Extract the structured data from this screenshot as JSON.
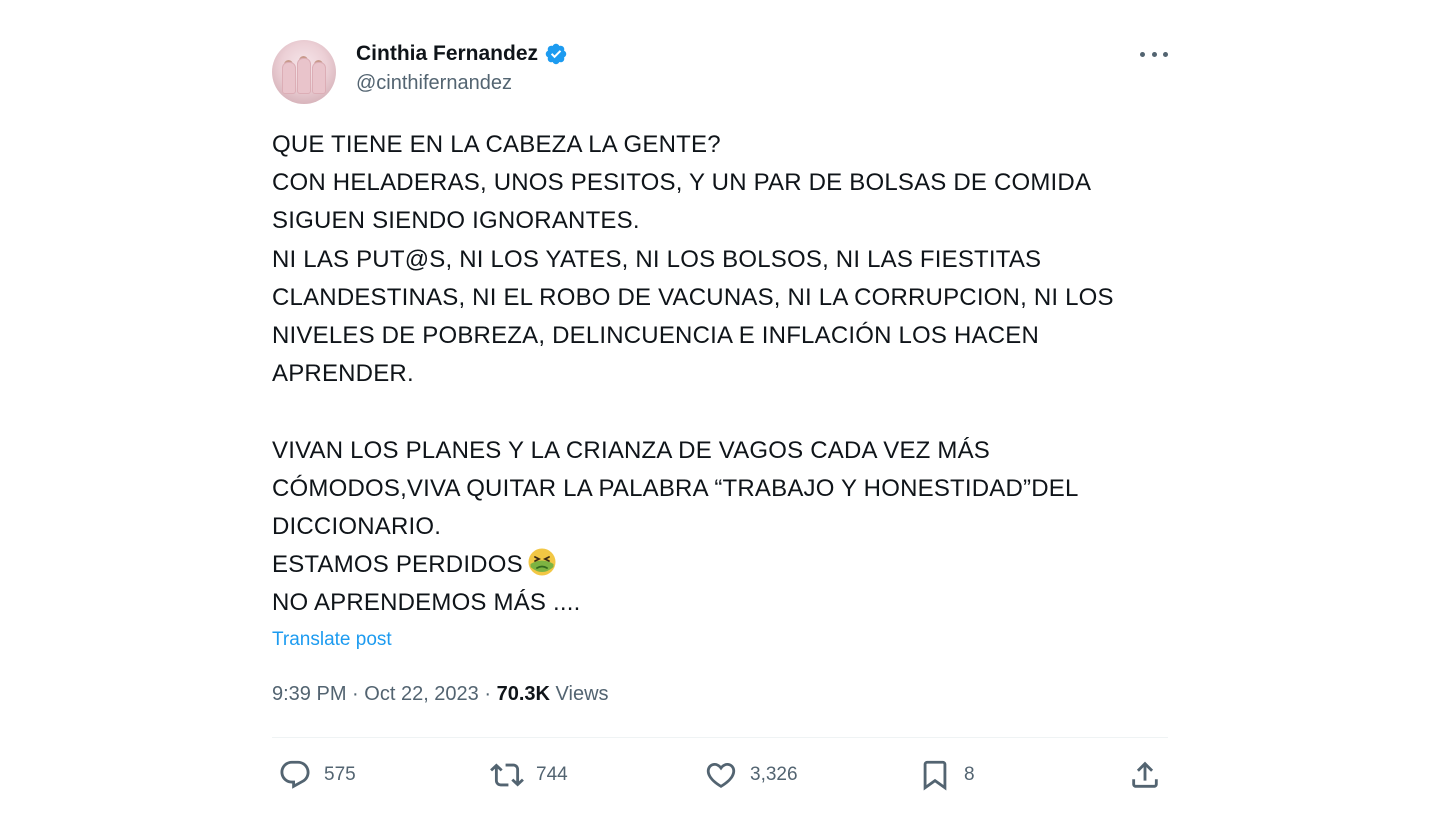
{
  "author": {
    "display_name": "Cinthia Fernandez",
    "handle": "@cinthifernandez",
    "verified_icon": "verified-badge-icon"
  },
  "tweet": {
    "lines": [
      "QUE TIENE EN LA CABEZA LA GENTE?",
      "CON HELADERAS, UNOS PESITOS, Y UN PAR DE BOLSAS DE COMIDA",
      "SIGUEN SIENDO IGNORANTES.",
      "NI LAS PUT@S, NI LOS YATES, NI LOS BOLSOS, NI LAS FIESTITAS",
      "CLANDESTINAS, NI EL ROBO DE VACUNAS, NI LA CORRUPCION, NI LOS",
      "NIVELES DE POBREZA, DELINCUENCIA E INFLACIÓN LOS HACEN",
      "APRENDER.",
      "",
      "VIVAN LOS PLANES Y LA CRIANZA DE VAGOS CADA VEZ MÁS",
      "CÓMODOS,VIVA QUITAR LA PALABRA “TRABAJO Y HONESTIDAD”DEL",
      "DICCIONARIO.",
      "ESTAMOS PERDIDOS",
      "NO APRENDEMOS MÁS ...."
    ],
    "emoji": "nauseated-face-icon",
    "translate_label": "Translate post"
  },
  "meta": {
    "time": "9:39 PM",
    "separator": "·",
    "date": "Oct 22, 2023",
    "views_count": "70.3K",
    "views_label": "Views"
  },
  "actions": {
    "replies": "575",
    "reposts": "744",
    "likes": "3,326",
    "bookmarks": "8"
  },
  "colors": {
    "text": "#0f1419",
    "secondary": "#536471",
    "link": "#1d9bf0",
    "verified": "#1d9bf0"
  }
}
